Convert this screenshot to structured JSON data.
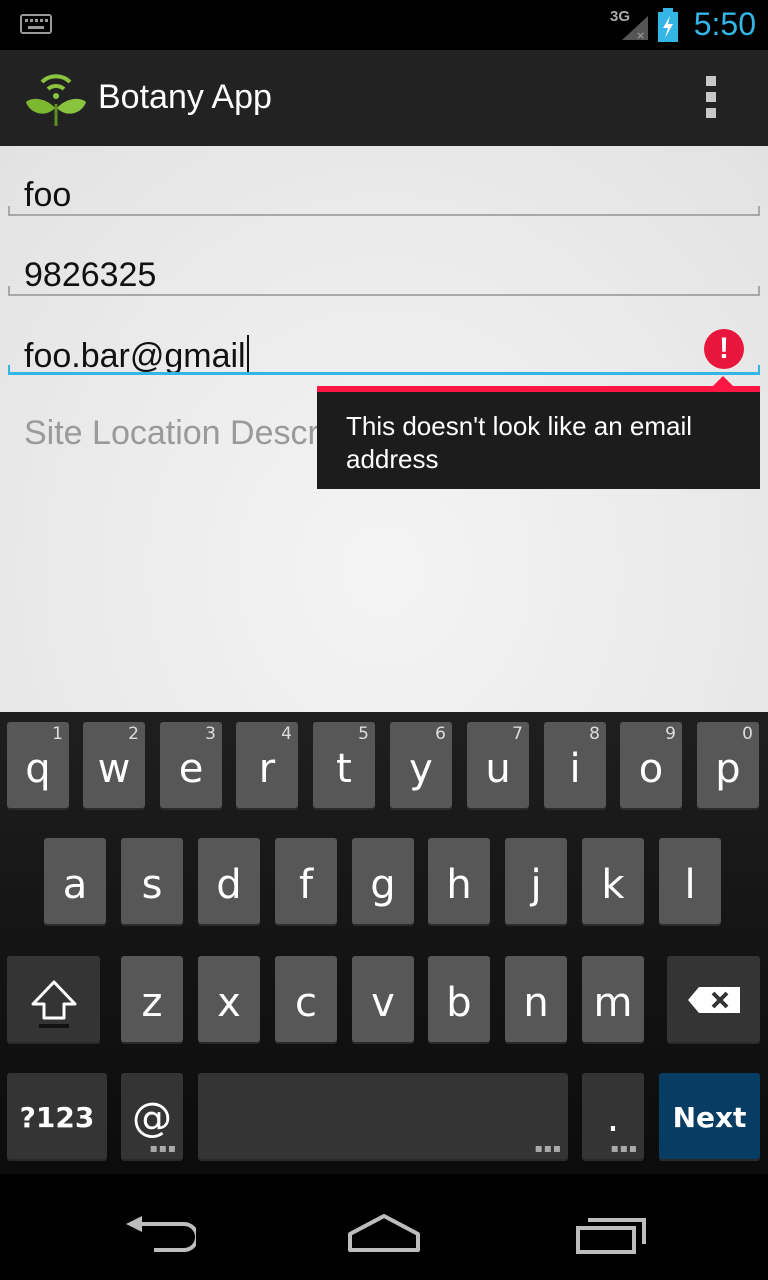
{
  "status_bar": {
    "network": "3G",
    "time": "5:50",
    "accent_color": "#33b5e5"
  },
  "action_bar": {
    "app_icon": "leaf-wifi-icon",
    "title": "Botany App",
    "overflow_icon": "overflow-menu-icon"
  },
  "form": {
    "field1": {
      "value": "foo"
    },
    "field2": {
      "value": "9826325"
    },
    "field3": {
      "value": "foo.bar@gmail",
      "error_icon": "error-icon",
      "error_message": "This doesn't look like an email address"
    },
    "field4": {
      "placeholder": "Site Location Description"
    }
  },
  "keyboard": {
    "row1": [
      {
        "ch": "q",
        "num": "1"
      },
      {
        "ch": "w",
        "num": "2"
      },
      {
        "ch": "e",
        "num": "3"
      },
      {
        "ch": "r",
        "num": "4"
      },
      {
        "ch": "t",
        "num": "5"
      },
      {
        "ch": "y",
        "num": "6"
      },
      {
        "ch": "u",
        "num": "7"
      },
      {
        "ch": "i",
        "num": "8"
      },
      {
        "ch": "o",
        "num": "9"
      },
      {
        "ch": "p",
        "num": "0"
      }
    ],
    "row2": [
      "a",
      "s",
      "d",
      "f",
      "g",
      "h",
      "j",
      "k",
      "l"
    ],
    "row3": [
      "z",
      "x",
      "c",
      "v",
      "b",
      "n",
      "m"
    ],
    "symbols_label": "?123",
    "at_label": "@",
    "period_label": ".",
    "next_label": "Next",
    "shift_icon": "shift-icon",
    "backspace_icon": "backspace-icon"
  },
  "nav_bar": {
    "back_icon": "back-icon",
    "home_icon": "home-icon",
    "recents_icon": "recent-apps-icon"
  }
}
